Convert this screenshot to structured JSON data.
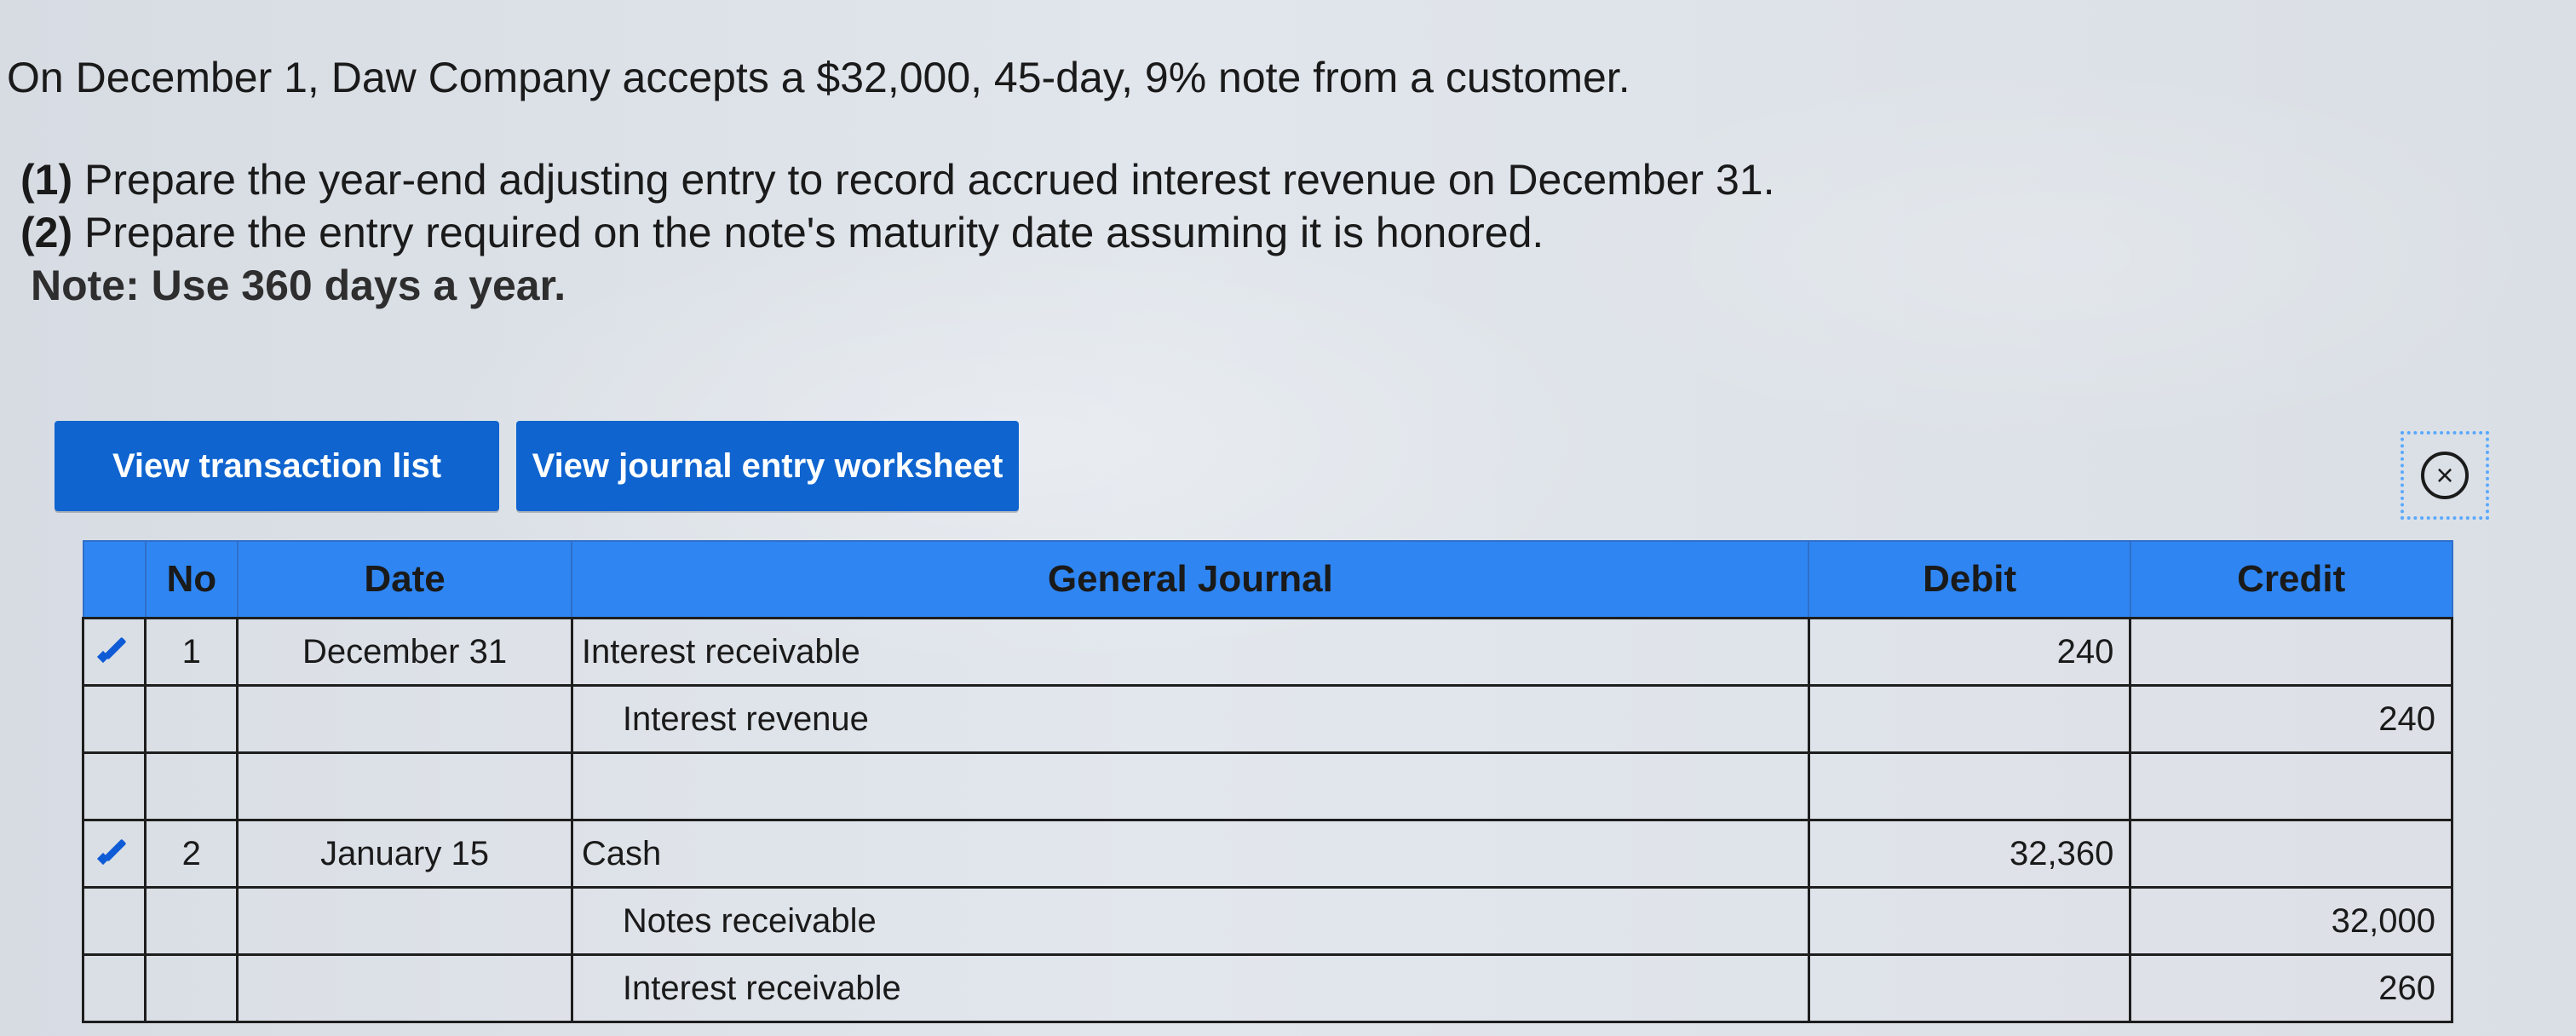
{
  "prompt": {
    "line1": "On December 1, Daw Company accepts a $32,000, 45-day, 9% note from a customer.",
    "req1_number": "(1)",
    "req1_text": "Prepare the year-end adjusting entry to record accrued interest revenue on December 31.",
    "req2_number": "(2)",
    "req2_text": "Prepare the entry required on the note's maturity date assuming it is honored.",
    "note": "Note: Use 360 days a year."
  },
  "buttons": {
    "transaction_list": "View transaction list",
    "journal_worksheet": "View journal entry worksheet"
  },
  "icons": {
    "close": "close-icon",
    "edit": "pencil-icon"
  },
  "table": {
    "headers": {
      "no": "No",
      "date": "Date",
      "journal": "General Journal",
      "debit": "Debit",
      "credit": "Credit"
    },
    "rows": [
      {
        "no": "1",
        "date": "December 31",
        "account": "Interest receivable",
        "debit": "240",
        "credit": ""
      },
      {
        "no": "",
        "date": "",
        "account": "Interest revenue",
        "debit": "",
        "credit": "240"
      },
      {
        "no": "",
        "date": "",
        "account": "",
        "debit": "",
        "credit": ""
      },
      {
        "no": "2",
        "date": "January 15",
        "account": "Cash",
        "debit": "32,360",
        "credit": ""
      },
      {
        "no": "",
        "date": "",
        "account": "Notes receivable",
        "debit": "",
        "credit": "32,000"
      },
      {
        "no": "",
        "date": "",
        "account": "Interest receivable",
        "debit": "",
        "credit": "260"
      }
    ]
  },
  "colors": {
    "button_blue": "#0f64cf",
    "header_blue": "#2f86f2",
    "focus_blue": "#5aa9ff"
  }
}
